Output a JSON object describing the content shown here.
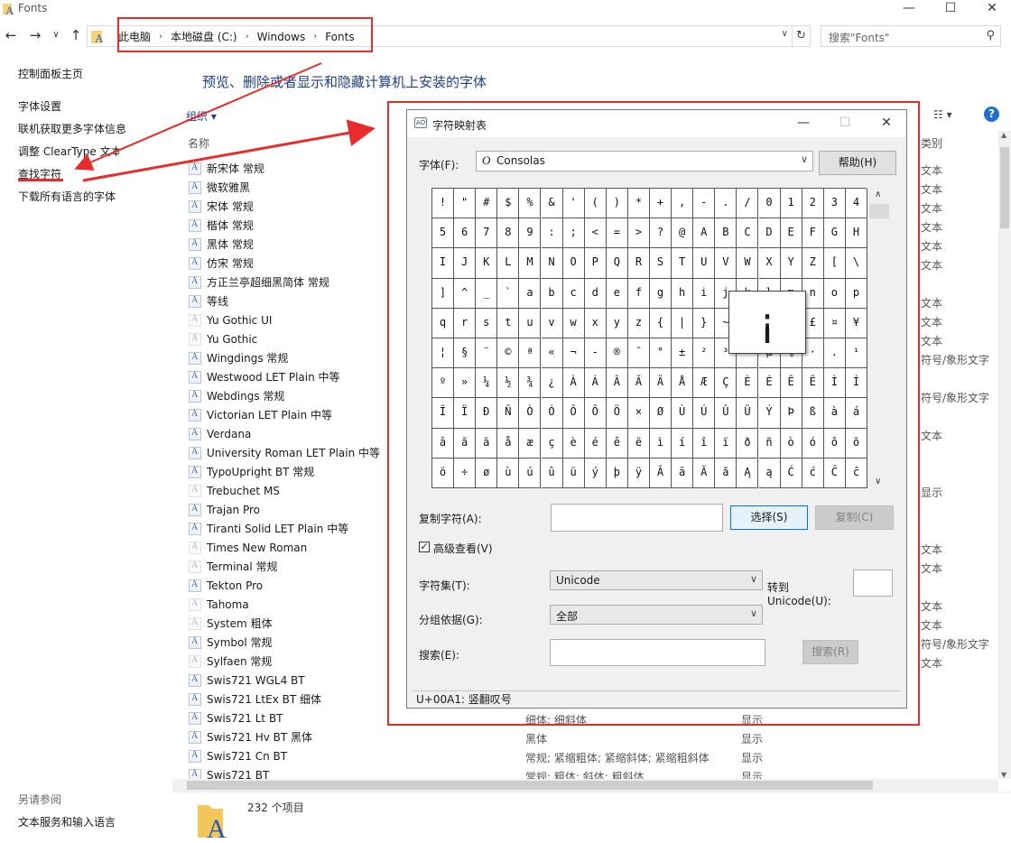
{
  "window": {
    "title": "Fonts",
    "minimize": "—",
    "maximize": "☐",
    "close": "✕"
  },
  "address": {
    "crumbs": [
      "此电脑",
      "本地磁盘 (C:)",
      "Windows",
      "Fonts"
    ],
    "search_placeholder": "搜索\"Fonts\""
  },
  "left_nav": {
    "home": "控制面板主页",
    "items": [
      "字体设置",
      "联机获取更多字体信息",
      "调整 ClearType 文本",
      "查找字符",
      "下载所有语言的字体"
    ],
    "see_also_title": "另请参阅",
    "see_also_items": [
      "文本服务和输入语言"
    ]
  },
  "main": {
    "heading": "预览、删除或者显示和隐藏计算机上安装的字体",
    "organize": "组织 ▾",
    "col_name": "名称",
    "col_type": "类别",
    "fonts": [
      {
        "name": "新宋体 常规",
        "icon": "font-icon",
        "type": "文本"
      },
      {
        "name": "微软雅黑",
        "icon": "font-family-icon",
        "type": "文本"
      },
      {
        "name": "宋体 常规",
        "icon": "font-icon",
        "type": "文本"
      },
      {
        "name": "楷体 常规",
        "icon": "font-icon",
        "type": "文本"
      },
      {
        "name": "黑体 常规",
        "icon": "font-icon",
        "type": "文本"
      },
      {
        "name": "仿宋 常规",
        "icon": "font-icon",
        "type": "文本"
      },
      {
        "name": "方正兰亭超细黑简体 常规",
        "icon": "font-icon",
        "type": ""
      },
      {
        "name": "等线",
        "icon": "font-family-icon",
        "type": "文本"
      },
      {
        "name": "Yu Gothic UI",
        "icon": "font-hidden-icon",
        "type": "文本"
      },
      {
        "name": "Yu Gothic",
        "icon": "font-hidden-icon",
        "type": "文本"
      },
      {
        "name": "Wingdings 常规",
        "icon": "font-icon",
        "type": "符号/象形文字"
      },
      {
        "name": "Westwood LET Plain 中等",
        "icon": "font-icon",
        "type": ""
      },
      {
        "name": "Webdings 常规",
        "icon": "font-icon",
        "type": "符号/象形文字"
      },
      {
        "name": "Victorian LET Plain 中等",
        "icon": "font-icon",
        "type": ""
      },
      {
        "name": "Verdana",
        "icon": "font-family-icon",
        "type": "文本"
      },
      {
        "name": "University Roman LET Plain 中等",
        "icon": "font-icon",
        "type": ""
      },
      {
        "name": "TypoUpright BT 常规",
        "icon": "font-icon",
        "type": ""
      },
      {
        "name": "Trebuchet MS",
        "icon": "font-hidden-icon",
        "type": "显示"
      },
      {
        "name": "Trajan Pro",
        "icon": "font-family-icon",
        "type": ""
      },
      {
        "name": "Tiranti Solid LET Plain 中等",
        "icon": "font-icon",
        "type": ""
      },
      {
        "name": "Times New Roman",
        "icon": "font-hidden-icon",
        "type": "文本"
      },
      {
        "name": "Terminal 常规",
        "icon": "font-hidden-icon",
        "type": "文本"
      },
      {
        "name": "Tekton Pro",
        "icon": "font-family-icon",
        "type": ""
      },
      {
        "name": "Tahoma",
        "icon": "font-hidden-icon",
        "type": "文本"
      },
      {
        "name": "System 粗体",
        "icon": "font-hidden-icon",
        "type": "文本"
      },
      {
        "name": "Symbol 常规",
        "icon": "font-icon",
        "type": "符号/象形文字"
      },
      {
        "name": "Sylfaen 常规",
        "icon": "font-hidden-icon",
        "type": "文本"
      },
      {
        "name": "Swis721 WGL4 BT",
        "icon": "font-family-icon",
        "type": ""
      },
      {
        "name": "Swis721 LtEx BT 细体",
        "icon": "font-icon",
        "type": ""
      },
      {
        "name": "Swis721 Lt BT",
        "icon": "font-family-icon",
        "style": "细体; 细斜体",
        "type2": "显示"
      },
      {
        "name": "Swis721 Hv BT 黑体",
        "icon": "font-icon",
        "style": "黑体",
        "type2": "显示"
      },
      {
        "name": "Swis721 Cn BT",
        "icon": "font-family-icon",
        "style": "常规; 紧缩粗体; 紧缩斜体; 紧缩粗斜体",
        "type2": "显示"
      },
      {
        "name": "Swis721 BT",
        "icon": "font-family-icon",
        "style": "常规; 粗体; 斜体; 粗斜体",
        "type2": "显示"
      }
    ],
    "status": "232 个项目"
  },
  "charmap": {
    "title": "字符映射表",
    "font_label": "字体(F):",
    "font_value": "Consolas",
    "help_btn": "帮助(H)",
    "chars": [
      "!",
      "\"",
      "#",
      "$",
      "%",
      "&",
      "'",
      "(",
      ")",
      "*",
      "+",
      ",",
      "-",
      ".",
      "/",
      "0",
      "1",
      "2",
      "3",
      "4",
      "5",
      "6",
      "7",
      "8",
      "9",
      ":",
      ";",
      "<",
      "=",
      ">",
      "?",
      "@",
      "A",
      "B",
      "C",
      "D",
      "E",
      "F",
      "G",
      "H",
      "I",
      "J",
      "K",
      "L",
      "M",
      "N",
      "O",
      "P",
      "Q",
      "R",
      "S",
      "T",
      "U",
      "V",
      "W",
      "X",
      "Y",
      "Z",
      "[",
      "\\",
      "]",
      "^",
      "_",
      "`",
      "a",
      "b",
      "c",
      "d",
      "e",
      "f",
      "g",
      "h",
      "i",
      "j",
      "k",
      "l",
      "m",
      "n",
      "o",
      "p",
      "q",
      "r",
      "s",
      "t",
      "u",
      "v",
      "w",
      "x",
      "y",
      "z",
      "{",
      "|",
      "}",
      "~",
      "",
      "¡",
      "¢",
      "£",
      "¤",
      "¥",
      "¦",
      "§",
      "¨",
      "©",
      "ª",
      "«",
      "¬",
      "-",
      "®",
      "¯",
      "°",
      "±",
      "²",
      "³",
      "´",
      "µ",
      "¶",
      "·",
      ".",
      "¹",
      "º",
      "»",
      "¼",
      "½",
      "¾",
      "¿",
      "À",
      "Á",
      "Â",
      "Ã",
      "Ä",
      "Å",
      "Æ",
      "Ç",
      "È",
      "É",
      "Ê",
      "Ë",
      "Ì",
      "Í",
      "Î",
      "Ï",
      "Ð",
      "Ñ",
      "Ò",
      "Ó",
      "Ô",
      "Õ",
      "Ö",
      "×",
      "Ø",
      "Ù",
      "Ú",
      "Û",
      "Ü",
      "Ý",
      "Þ",
      "ß",
      "à",
      "á",
      "â",
      "ã",
      "ä",
      "å",
      "æ",
      "ç",
      "è",
      "é",
      "ê",
      "ë",
      "ì",
      "í",
      "î",
      "ï",
      "ð",
      "ñ",
      "ò",
      "ó",
      "ô",
      "õ",
      "ö",
      "÷",
      "ø",
      "ù",
      "ú",
      "û",
      "ü",
      "ý",
      "þ",
      "ÿ",
      "Ā",
      "ā",
      "Ă",
      "ă",
      "Ą",
      "ą",
      "Ć",
      "ć",
      "Ĉ",
      "ĉ"
    ],
    "zoom_char": "¡",
    "copy_label": "复制字符(A):",
    "copy_value": "",
    "select_btn": "选择(S)",
    "copy_btn": "复制(C)",
    "advanced_label": "高级查看(V)",
    "charset_label": "字符集(T):",
    "charset_value": "Unicode",
    "goto_label": "转到",
    "goto_label2": "Unicode(U):",
    "group_label": "分组依据(G):",
    "group_value": "全部",
    "search_label": "搜索(E):",
    "search_btn": "搜索(R)",
    "status": "U+00A1: 竖翻叹号"
  },
  "colors": {
    "annotation_red": "#e82b2b",
    "link_blue": "#1e3e8c"
  }
}
